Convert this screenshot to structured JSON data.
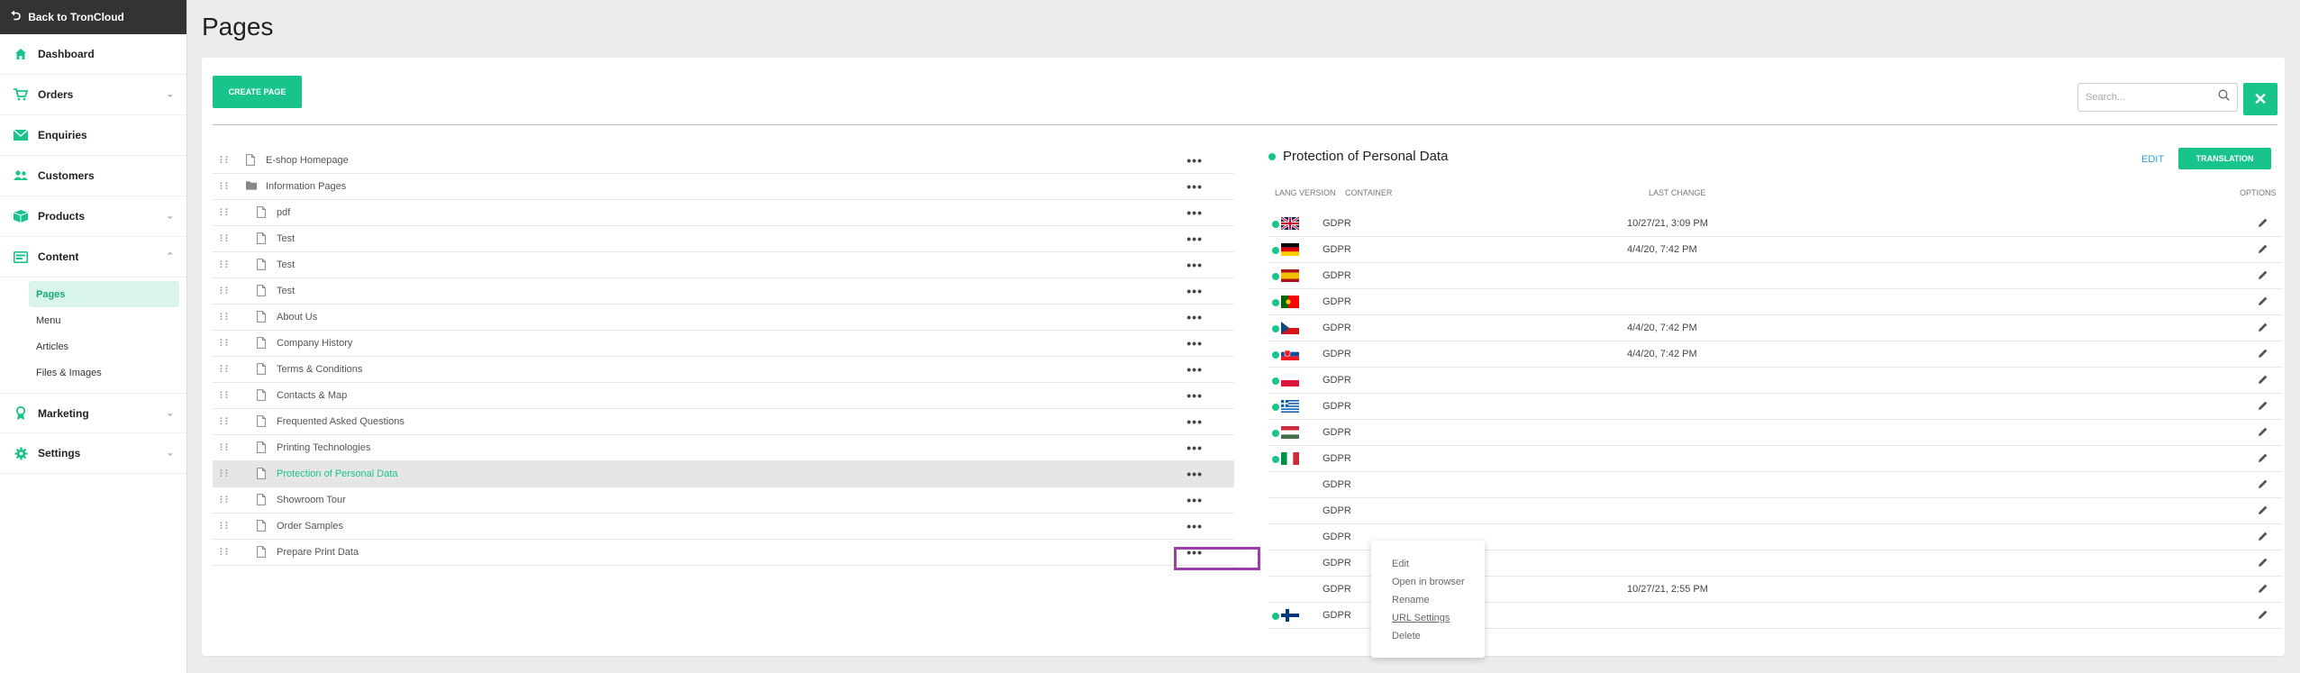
{
  "sidebar": {
    "back_label": "Back to TronCloud",
    "items": [
      {
        "label": "Dashboard",
        "icon": "home-icon"
      },
      {
        "label": "Orders",
        "icon": "cart-icon"
      },
      {
        "label": "Enquiries",
        "icon": "envelope-icon"
      },
      {
        "label": "Customers",
        "icon": "users-icon"
      },
      {
        "label": "Products",
        "icon": "box-icon"
      },
      {
        "label": "Content",
        "icon": "content-icon"
      },
      {
        "label": "Marketing",
        "icon": "marketing-icon"
      },
      {
        "label": "Settings",
        "icon": "gear-icon"
      }
    ],
    "content_sub": [
      "Pages",
      "Menu",
      "Articles",
      "Files & Images"
    ]
  },
  "page": {
    "title": "Pages",
    "create_label": "CREATE PAGE",
    "search_placeholder": "Search..."
  },
  "tree": [
    {
      "label": "E-shop Homepage",
      "indent": 0,
      "type": "page"
    },
    {
      "label": "Information Pages",
      "indent": 0,
      "type": "folder"
    },
    {
      "label": "pdf",
      "indent": 1,
      "type": "page"
    },
    {
      "label": "Test",
      "indent": 1,
      "type": "page"
    },
    {
      "label": "Test",
      "indent": 1,
      "type": "page"
    },
    {
      "label": "Test",
      "indent": 1,
      "type": "page"
    },
    {
      "label": "About Us",
      "indent": 1,
      "type": "page"
    },
    {
      "label": "Company History",
      "indent": 1,
      "type": "page"
    },
    {
      "label": "Terms & Conditions",
      "indent": 1,
      "type": "page"
    },
    {
      "label": "Contacts & Map",
      "indent": 1,
      "type": "page"
    },
    {
      "label": "Frequented Asked Questions",
      "indent": 1,
      "type": "page"
    },
    {
      "label": "Printing Technologies",
      "indent": 1,
      "type": "page"
    },
    {
      "label": "Protection of Personal Data",
      "indent": 1,
      "type": "page",
      "selected": true
    },
    {
      "label": "Showroom Tour",
      "indent": 1,
      "type": "page"
    },
    {
      "label": "Order Samples",
      "indent": 1,
      "type": "page"
    },
    {
      "label": "Prepare Print Data",
      "indent": 1,
      "type": "page"
    }
  ],
  "context_menu": [
    "Edit",
    "Open in browser",
    "Rename",
    "URL Settings",
    "Delete"
  ],
  "panel": {
    "title": "Protection of Personal Data",
    "edit_label": "EDIT",
    "translation_label": "TRANSLATION",
    "headers": {
      "lang": "LANG VERSION",
      "container": "CONTAINER",
      "last_change": "LAST CHANGE",
      "options": "OPTIONS"
    },
    "rows": [
      {
        "flag": "uk",
        "container": "GDPR",
        "last_change": "10/27/21, 3:09 PM"
      },
      {
        "flag": "de",
        "container": "GDPR",
        "last_change": "4/4/20, 7:42 PM"
      },
      {
        "flag": "es",
        "container": "GDPR",
        "last_change": ""
      },
      {
        "flag": "pt",
        "container": "GDPR",
        "last_change": ""
      },
      {
        "flag": "cz",
        "container": "GDPR",
        "last_change": "4/4/20, 7:42 PM"
      },
      {
        "flag": "sk",
        "container": "GDPR",
        "last_change": "4/4/20, 7:42 PM"
      },
      {
        "flag": "pl",
        "container": "GDPR",
        "last_change": ""
      },
      {
        "flag": "gr",
        "container": "GDPR",
        "last_change": ""
      },
      {
        "flag": "hu",
        "container": "GDPR",
        "last_change": ""
      },
      {
        "flag": "it",
        "container": "GDPR",
        "last_change": ""
      },
      {
        "flag": "hidden",
        "container": "GDPR",
        "last_change": ""
      },
      {
        "flag": "hidden",
        "container": "GDPR",
        "last_change": ""
      },
      {
        "flag": "hidden",
        "container": "GDPR",
        "last_change": ""
      },
      {
        "flag": "hidden",
        "container": "GDPR",
        "last_change": ""
      },
      {
        "flag": "hidden",
        "container": "GDPR",
        "last_change": "10/27/21, 2:55 PM"
      },
      {
        "flag": "fi",
        "container": "GDPR",
        "last_change": ""
      }
    ]
  },
  "colors": {
    "accent": "#19c48c",
    "highlight": "#9b3fa8",
    "link": "#2e9fe0"
  }
}
